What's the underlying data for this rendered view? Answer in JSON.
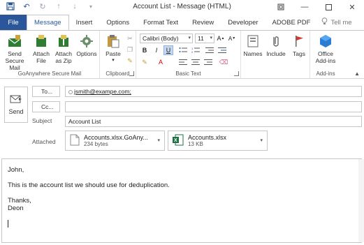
{
  "window": {
    "title": "Account List  -  Message (HTML)",
    "controls": [
      "restore-down",
      "minimize",
      "close"
    ]
  },
  "qat": {
    "icons": [
      "save-icon",
      "undo-icon",
      "redo-icon",
      "up-arrow-icon",
      "down-arrow-icon",
      "customize-icon"
    ]
  },
  "tabs": [
    {
      "label": "File"
    },
    {
      "label": "Message"
    },
    {
      "label": "Insert"
    },
    {
      "label": "Options"
    },
    {
      "label": "Format Text"
    },
    {
      "label": "Review"
    },
    {
      "label": "Developer"
    },
    {
      "label": "ADOBE PDF"
    }
  ],
  "tell_me": "Tell me",
  "ribbon": {
    "goanywhere": {
      "label": "GoAnywhere Secure Mail",
      "send_secure_1": "Send",
      "send_secure_2": "Secure Mail",
      "attach_file_1": "Attach",
      "attach_file_2": "File",
      "attach_zip_1": "Attach",
      "attach_zip_2": "as Zip",
      "options": "Options"
    },
    "clipboard": {
      "label": "Clipboard",
      "paste": "Paste"
    },
    "basic_text": {
      "label": "Basic Text",
      "font_name": "Calibri (Body)",
      "font_size": "11",
      "bold": "B",
      "italic": "I",
      "underline": "U"
    },
    "names": "Names",
    "include": "Include",
    "tags": "Tags",
    "addins": {
      "label": "Add-ins",
      "office_1": "Office",
      "office_2": "Add-ins"
    }
  },
  "compose": {
    "send": "Send",
    "to_label": "To...",
    "to_value": "jsmith@exampe.com;",
    "cc_label": "Cc...",
    "cc_value": "",
    "subject_label": "Subject",
    "subject_value": "Account List",
    "attached_label": "Attached",
    "attachments": [
      {
        "name": "Accounts.xlsx.GoAny...",
        "size": "234 bytes"
      },
      {
        "name": "Accounts.xlsx",
        "size": "13 KB"
      }
    ]
  },
  "body": {
    "lines": [
      "John,",
      "",
      "This is the account list we should use for deduplication.",
      "",
      "Thanks,",
      "Deon"
    ]
  },
  "colors": {
    "accent": "#2b579a",
    "excel_green": "#1e7145"
  }
}
